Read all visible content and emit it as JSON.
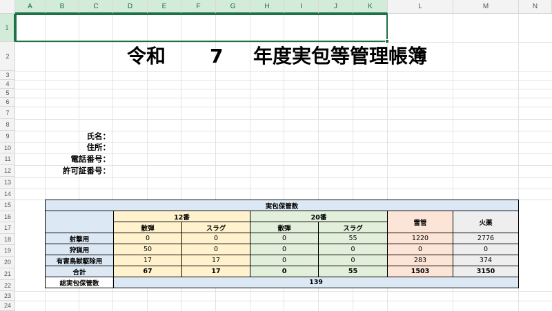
{
  "sheet": {
    "columns": [
      "A",
      "B",
      "C",
      "D",
      "E",
      "F",
      "G",
      "H",
      "I",
      "J",
      "K",
      "L",
      "M",
      "N"
    ],
    "rows": [
      "1",
      "2",
      "3",
      "4",
      "5",
      "6",
      "7",
      "8",
      "9",
      "10",
      "11",
      "12",
      "13",
      "14",
      "15",
      "16",
      "17",
      "18",
      "19",
      "20",
      "21",
      "22",
      "23",
      "24"
    ]
  },
  "title": {
    "prefix": "令和",
    "year": "7",
    "suffix": "年度実包等管理帳簿"
  },
  "info_labels": {
    "name": "氏名：",
    "address": "住所：",
    "phone": "電話番号：",
    "permit": "許可証番号："
  },
  "table": {
    "header": "実包保管数",
    "group_12": "12番",
    "group_20": "20番",
    "detonator": "雷管",
    "powder": "火薬",
    "shot": "散弾",
    "slug": "スラグ",
    "rows": [
      {
        "label": "射撃用",
        "v": [
          "0",
          "0",
          "0",
          "55",
          "1220",
          "2776"
        ]
      },
      {
        "label": "狩猟用",
        "v": [
          "50",
          "0",
          "0",
          "0",
          "0",
          "0"
        ]
      },
      {
        "label": "有害鳥獣駆除用",
        "v": [
          "17",
          "17",
          "0",
          "0",
          "283",
          "374"
        ]
      },
      {
        "label": "合計",
        "v": [
          "67",
          "17",
          "0",
          "55",
          "1503",
          "3150"
        ]
      }
    ],
    "total_label": "総実包保管数",
    "total_value": "139"
  }
}
